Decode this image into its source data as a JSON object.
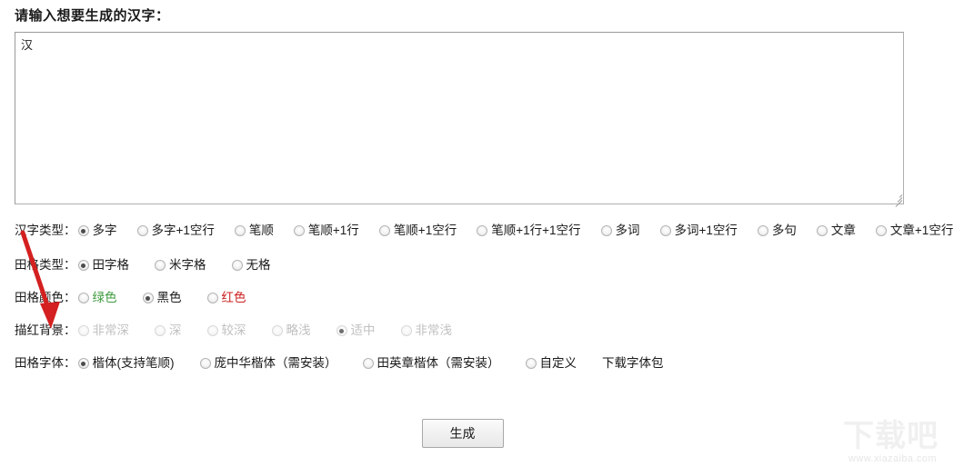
{
  "page": {
    "title": "请输入想要生成的汉字："
  },
  "input": {
    "name": "hanzi-textarea",
    "value": "汉",
    "placeholder": ""
  },
  "rows": [
    {
      "key": "hanzi_type",
      "label": "汉字类型：",
      "options": [
        {
          "label": "多字",
          "checked": true,
          "disabled": false
        },
        {
          "label": "多字+1空行",
          "checked": false,
          "disabled": false
        },
        {
          "label": "笔顺",
          "checked": false,
          "disabled": false
        },
        {
          "label": "笔顺+1行",
          "checked": false,
          "disabled": false
        },
        {
          "label": "笔顺+1空行",
          "checked": false,
          "disabled": false
        },
        {
          "label": "笔顺+1行+1空行",
          "checked": false,
          "disabled": false
        },
        {
          "label": "多词",
          "checked": false,
          "disabled": false
        },
        {
          "label": "多词+1空行",
          "checked": false,
          "disabled": false
        },
        {
          "label": "多句",
          "checked": false,
          "disabled": false
        },
        {
          "label": "文章",
          "checked": false,
          "disabled": false
        },
        {
          "label": "文章+1空行",
          "checked": false,
          "disabled": false
        }
      ]
    },
    {
      "key": "grid_type",
      "label": "田格类型：",
      "options": [
        {
          "label": "田字格",
          "checked": true,
          "disabled": false
        },
        {
          "label": "米字格",
          "checked": false,
          "disabled": false
        },
        {
          "label": "无格",
          "checked": false,
          "disabled": false
        }
      ]
    },
    {
      "key": "grid_color",
      "label": "田格颜色：",
      "options": [
        {
          "label": "绿色",
          "checked": false,
          "disabled": false,
          "color": "green"
        },
        {
          "label": "黑色",
          "checked": true,
          "disabled": false,
          "color": "black"
        },
        {
          "label": "红色",
          "checked": false,
          "disabled": false,
          "color": "red"
        }
      ]
    },
    {
      "key": "trace_background",
      "label": "描红背景：",
      "options": [
        {
          "label": "非常深",
          "checked": false,
          "disabled": true
        },
        {
          "label": "深",
          "checked": false,
          "disabled": true
        },
        {
          "label": "较深",
          "checked": false,
          "disabled": true
        },
        {
          "label": "略浅",
          "checked": false,
          "disabled": true
        },
        {
          "label": "适中",
          "checked": true,
          "disabled": true
        },
        {
          "label": "非常浅",
          "checked": false,
          "disabled": true
        }
      ]
    },
    {
      "key": "grid_font",
      "label": "田格字体：",
      "options": [
        {
          "label": "楷体(支持笔顺)",
          "checked": true,
          "disabled": false
        },
        {
          "label": "庞中华楷体（需安装）",
          "checked": false,
          "disabled": false
        },
        {
          "label": "田英章楷体（需安装）",
          "checked": false,
          "disabled": false
        },
        {
          "label": "自定义",
          "checked": false,
          "disabled": false
        }
      ],
      "extra_link": "下载字体包"
    }
  ],
  "submit": {
    "label": "生成"
  },
  "annotation": {
    "type": "red-arrow",
    "color": "#d42020",
    "points_to": "田格颜色"
  },
  "watermark": {
    "logo": "下载吧",
    "url": "www.xiazaiba.com",
    "color": "#eeeeee"
  },
  "colors": {
    "green_label": "#3f9b3f",
    "red_label": "#cc2222",
    "text": "#1a1a1a",
    "disabled_text": "#c0c0c0",
    "border": "#aeaeae"
  }
}
